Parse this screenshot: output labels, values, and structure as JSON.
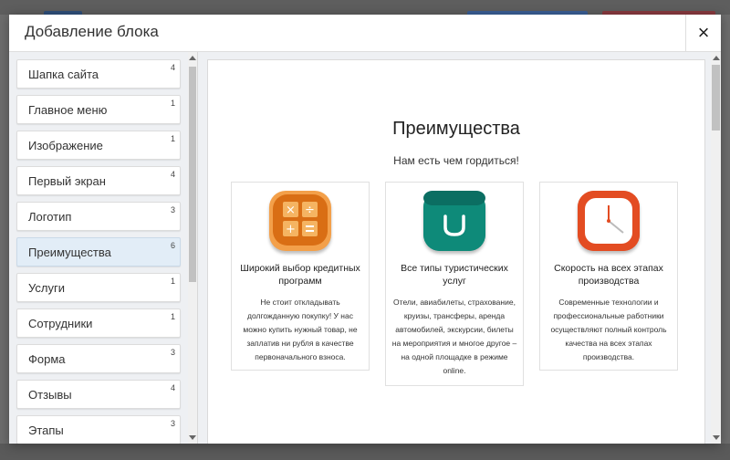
{
  "dialog": {
    "title": "Добавление блока",
    "close_label": "×"
  },
  "sidebar": {
    "items": [
      {
        "label": "Шапка сайта",
        "count": "4"
      },
      {
        "label": "Главное меню",
        "count": "1"
      },
      {
        "label": "Изображение",
        "count": "1"
      },
      {
        "label": "Первый экран",
        "count": "4"
      },
      {
        "label": "Логотип",
        "count": "3"
      },
      {
        "label": "Преимущества",
        "count": "6",
        "active": true
      },
      {
        "label": "Услуги",
        "count": "1"
      },
      {
        "label": "Сотрудники",
        "count": "1"
      },
      {
        "label": "Форма",
        "count": "3"
      },
      {
        "label": "Отзывы",
        "count": "4"
      },
      {
        "label": "Этапы",
        "count": "3"
      }
    ]
  },
  "preview": {
    "title": "Преимущества",
    "subtitle": "Нам есть чем гордиться!",
    "features": [
      {
        "icon": "calculator-icon",
        "icon_color": "#e07a1a",
        "title": "Широкий выбор кредитных программ",
        "text": "Не стоит откладывать долгожданную покупку! У нас можно купить нужный товар, не заплатив ни рубля в качестве первоначального взноса."
      },
      {
        "icon": "bag-icon",
        "icon_color": "#0f8a7a",
        "title": "Все типы туристических услуг",
        "text": "Отели, авиабилеты, страхование, круизы, трансферы, аренда автомобилей, экскурсии, билеты на мероприятия и многое другое – на одной площадке в режиме online."
      },
      {
        "icon": "clock-icon",
        "icon_color": "#e34c22",
        "title": "Скорость на всех этапах производства",
        "text": "Современные технологии и профессиональные работники осуществляют полный контроль качества на всех этапах производства."
      }
    ]
  }
}
